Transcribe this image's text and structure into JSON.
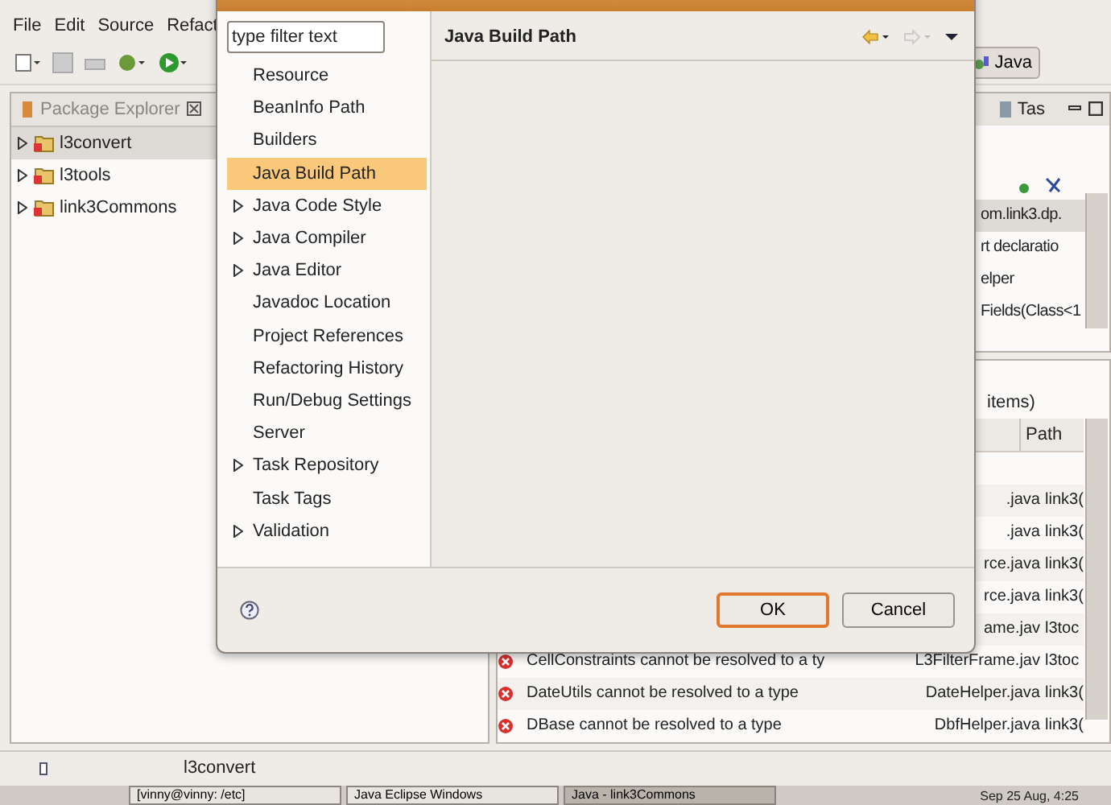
{
  "menu": [
    "File",
    "Edit",
    "Source",
    "Refact"
  ],
  "perspective": {
    "label": "Java"
  },
  "package_explorer": {
    "title": "Package Explorer",
    "items": [
      {
        "label": "l3convert",
        "selected": true
      },
      {
        "label": "l3tools",
        "selected": false
      },
      {
        "label": "link3Commons",
        "selected": false
      }
    ]
  },
  "outline": {
    "tab": "Tas",
    "rows": [
      {
        "text": "om.link3.dp.",
        "selected": true
      },
      {
        "text": "rt declaratio",
        "selected": false
      },
      {
        "text": "elper",
        "selected": false
      },
      {
        "text": "Fields(Class<1",
        "selected": false
      }
    ]
  },
  "problems": {
    "summary": "items)",
    "column": "Path",
    "rows": [
      {
        "resource": ".java",
        "path": "link3("
      },
      {
        "resource": ".java",
        "path": "link3("
      },
      {
        "resource": "rce.java",
        "path": "link3("
      },
      {
        "resource": "rce.java",
        "path": "link3("
      },
      {
        "resource": "ame.jav",
        "path": "l3toc"
      },
      {
        "description": "CellConstraints cannot be resolved to a ty",
        "resource": "L3FilterFrame.jav",
        "path": "l3toc"
      },
      {
        "description": "DateUtils cannot be resolved to a type",
        "resource": "DateHelper.java",
        "path": "link3("
      },
      {
        "description": "DBase cannot be resolved to a type",
        "resource": "DbfHelper.java",
        "path": "link3("
      }
    ]
  },
  "status_bar": {
    "text": "l3convert"
  },
  "taskbar": {
    "windows": [
      {
        "label": "[vinny@vinny: /etc]",
        "selected": false
      },
      {
        "label": "Java Eclipse Windows",
        "selected": false
      },
      {
        "label": "Java - link3Commons",
        "selected": true
      }
    ],
    "clock": "Sep 25 Aug, 4:25"
  },
  "dialog": {
    "filter_placeholder": "type filter text",
    "page_title": "Java Build Path",
    "pages": [
      {
        "label": "Resource",
        "expandable": false,
        "selected": false
      },
      {
        "label": "BeanInfo Path",
        "expandable": false,
        "selected": false
      },
      {
        "label": "Builders",
        "expandable": false,
        "selected": false
      },
      {
        "label": "Java Build Path",
        "expandable": false,
        "selected": true
      },
      {
        "label": "Java Code Style",
        "expandable": true,
        "selected": false
      },
      {
        "label": "Java Compiler",
        "expandable": true,
        "selected": false
      },
      {
        "label": "Java Editor",
        "expandable": true,
        "selected": false
      },
      {
        "label": "Javadoc Location",
        "expandable": false,
        "selected": false
      },
      {
        "label": "Project References",
        "expandable": false,
        "selected": false
      },
      {
        "label": "Refactoring History",
        "expandable": false,
        "selected": false
      },
      {
        "label": "Run/Debug Settings",
        "expandable": false,
        "selected": false
      },
      {
        "label": "Server",
        "expandable": false,
        "selected": false
      },
      {
        "label": "Task Repository",
        "expandable": true,
        "selected": false
      },
      {
        "label": "Task Tags",
        "expandable": false,
        "selected": false
      },
      {
        "label": "Validation",
        "expandable": true,
        "selected": false
      }
    ],
    "buttons": [
      {
        "label": "OK",
        "default": true
      },
      {
        "label": "Cancel",
        "default": false
      }
    ]
  }
}
